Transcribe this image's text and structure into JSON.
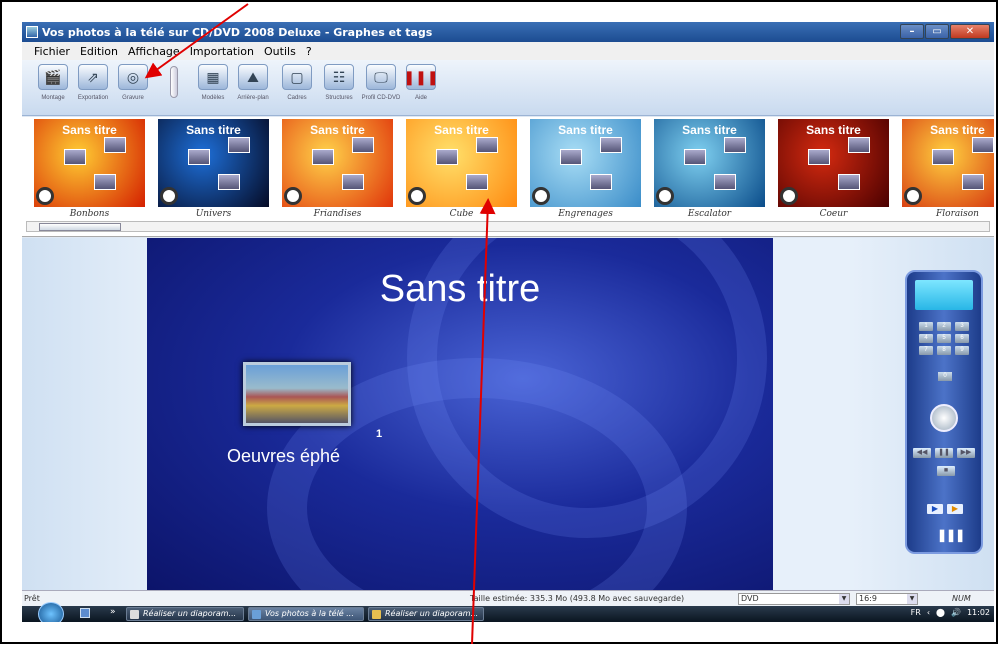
{
  "window": {
    "title": "Vos photos à la télé sur CD/DVD 2008 Deluxe - Graphes et tags"
  },
  "menu": [
    "Fichier",
    "Edition",
    "Affichage",
    "Importation",
    "Outils",
    "?"
  ],
  "toolbar": [
    {
      "label": "Montage",
      "icon": "clapper-icon"
    },
    {
      "label": "Exportation",
      "icon": "export-icon"
    },
    {
      "label": "Gravure",
      "icon": "disc-icon"
    },
    {
      "label": "Modèles",
      "icon": "templates-icon"
    },
    {
      "label": "Arrière-plan",
      "icon": "background-icon"
    },
    {
      "label": "Cadres",
      "icon": "frames-icon"
    },
    {
      "label": "Structures",
      "icon": "structures-icon"
    },
    {
      "label": "Profil CD-DVD",
      "icon": "monitor-icon"
    },
    {
      "label": "Aide",
      "icon": "help-icon"
    }
  ],
  "themes": [
    {
      "name": "Bonbons",
      "title": "Sans titre",
      "c1": "#ffcc33",
      "c2": "#d41f00"
    },
    {
      "name": "Univers",
      "title": "Sans titre",
      "c1": "#1e6fd8",
      "c2": "#050a24"
    },
    {
      "name": "Friandises",
      "title": "Sans titre",
      "c1": "#ffd24a",
      "c2": "#e0340a"
    },
    {
      "name": "Cube",
      "title": "Sans titre",
      "c1": "#ffe06a",
      "c2": "#ff8a10"
    },
    {
      "name": "Engrenages",
      "title": "Sans titre",
      "c1": "#a8ddf5",
      "c2": "#3a8cc8"
    },
    {
      "name": "Escalator",
      "title": "Sans titre",
      "c1": "#7fd0f0",
      "c2": "#0a4c8a"
    },
    {
      "name": "Coeur",
      "title": "Sans titre",
      "c1": "#d42a10",
      "c2": "#4a0000"
    },
    {
      "name": "Floraison",
      "title": "Sans titre",
      "c1": "#ffd040",
      "c2": "#d02008"
    }
  ],
  "preview": {
    "menu_title": "Sans titre",
    "chapter_label": "Oeuvres éphé",
    "chapter_number": "1"
  },
  "status": {
    "ready": "Prêt",
    "size": "Taille estimée: 335.3 Mo  (493.8 Mo avec sauvegarde)",
    "media": "DVD",
    "ratio": "16:9",
    "num": "NUM"
  },
  "taskbar": {
    "tasks": [
      "Réaliser un diaporam...",
      "Vos photos à la télé ...",
      "Réaliser un diaporam..."
    ],
    "lang": "FR",
    "time": "11:02"
  },
  "remote_keys": [
    "1",
    "2",
    "3",
    "4",
    "5",
    "6",
    "7",
    "8",
    "9"
  ],
  "remote_zero": "0"
}
